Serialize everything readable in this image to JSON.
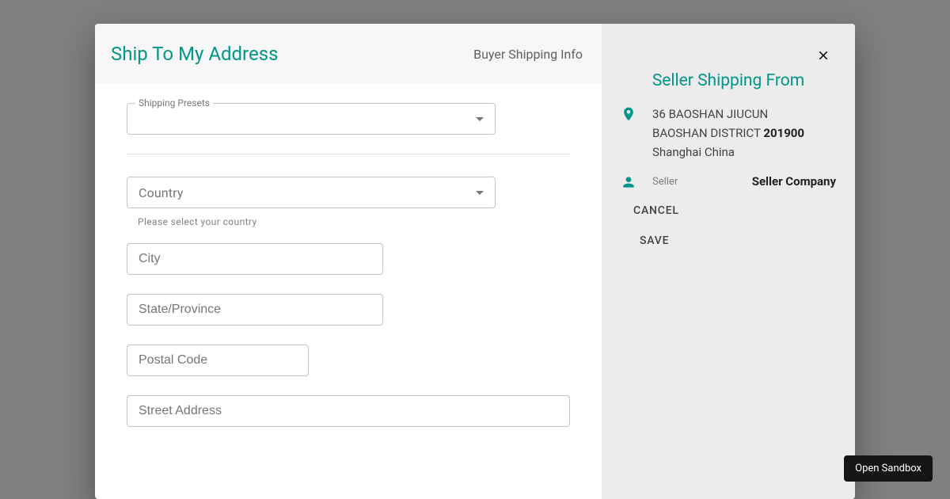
{
  "header": {
    "title": "Ship To My Address",
    "subtitle": "Buyer Shipping Info"
  },
  "form": {
    "presets_label": "Shipping Presets",
    "country_label": "Country",
    "country_helper": "Please select your country",
    "city_placeholder": "City",
    "state_placeholder": "State/Province",
    "postal_placeholder": "Postal Code",
    "street_placeholder": "Street Address"
  },
  "right": {
    "title": "Seller Shipping From",
    "address_line1": "36 BAOSHAN JIUCUN",
    "address_line2": "BAOSHAN DISTRICT",
    "postal_code": "201900",
    "city_country": "Shanghai China",
    "seller_label": "Seller",
    "seller_name": "Seller Company",
    "cancel_label": "CANCEL",
    "save_label": "SAVE"
  },
  "sandbox_label": "Open Sandbox"
}
